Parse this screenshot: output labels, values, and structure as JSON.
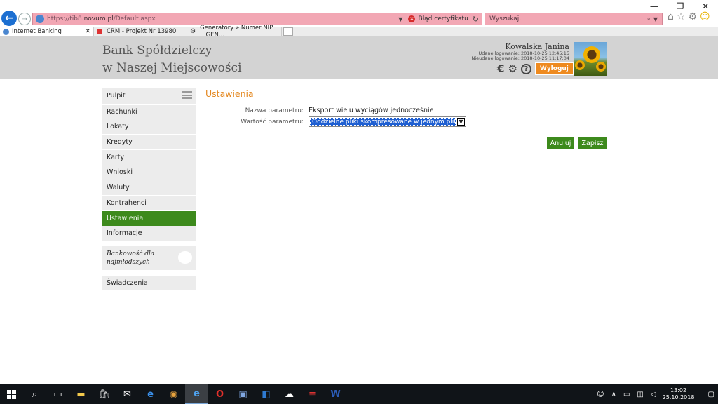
{
  "browser": {
    "url_prefix": "https://tib8.",
    "url_domain": "novum.pl",
    "url_suffix": "/Default.aspx",
    "cert_error": "Błąd certyfikatu",
    "search_placeholder": "Wyszukaj...",
    "tabs": [
      {
        "label": "Internet Banking"
      },
      {
        "label": "CRM - Projekt Nr 13980"
      },
      {
        "label": "Generatory » Numer NIP :: GEN..."
      }
    ]
  },
  "header": {
    "bank_line1": "Bank Spółdzielczy",
    "bank_line2": "w Naszej Miejscowości",
    "user_name": "Kowalska Janina",
    "last_login": "Udane logowanie: 2018-10-25 12:45:15",
    "failed_login": "Nieudane logowanie: 2018-10-25 11:17:04",
    "logout_label": "Wyloguj"
  },
  "sidebar": {
    "items": [
      {
        "label": "Pulpit"
      },
      {
        "label": "Rachunki"
      },
      {
        "label": "Lokaty"
      },
      {
        "label": "Kredyty"
      },
      {
        "label": "Karty"
      },
      {
        "label": "Wnioski"
      },
      {
        "label": "Waluty"
      },
      {
        "label": "Kontrahenci"
      },
      {
        "label": "Ustawienia"
      },
      {
        "label": "Informacje"
      }
    ],
    "promo_line1": "Bankowość dla",
    "promo_line2": "najmłodszych",
    "last_item": "Świadczenia"
  },
  "main": {
    "title": "Ustawienia",
    "param_name_label": "Nazwa parametru:",
    "param_name_value": "Eksport wielu wyciągów jednocześnie",
    "param_value_label": "Wartość parametru:",
    "param_value_selected": "Oddzielne pliki skompresowane w jednym pliku ZIP",
    "cancel_label": "Anuluj",
    "save_label": "Zapisz"
  },
  "taskbar": {
    "time": "13:02",
    "date": "25.10.2018"
  },
  "colors": {
    "accent_green": "#3d8a1c",
    "title_orange": "#e48a24",
    "logout_orange": "#ee8a1f"
  }
}
